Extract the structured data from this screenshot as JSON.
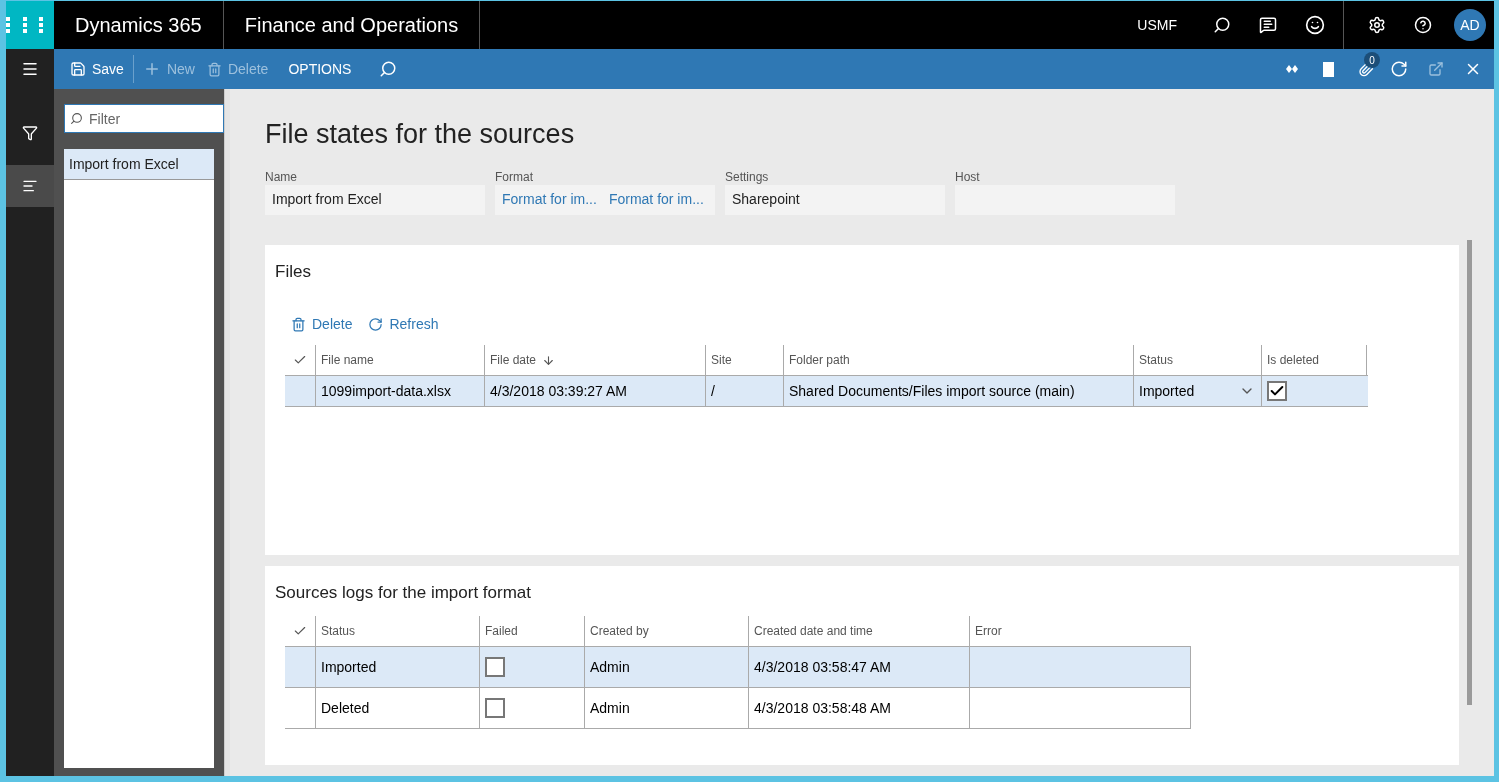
{
  "header": {
    "product": "Dynamics 365",
    "module": "Finance and Operations",
    "company": "USMF",
    "avatar": "AD"
  },
  "action_bar": {
    "buttons": [
      {
        "kind": "save",
        "label": "Save",
        "disabled": false
      },
      {
        "kind": "new",
        "label": "New",
        "disabled": true
      },
      {
        "kind": "delete",
        "label": "Delete",
        "disabled": true
      },
      {
        "kind": "text",
        "label": "OPTIONS",
        "disabled": false
      }
    ],
    "attachments_count": "0"
  },
  "nav_pane": {
    "filter": {
      "placeholder": "Filter"
    },
    "items": [
      {
        "label": "Import from Excel",
        "selected": true
      }
    ]
  },
  "page": {
    "title": "File states for the sources",
    "fields": [
      {
        "label": "Name",
        "kind": "text",
        "values": [
          "Import from Excel"
        ]
      },
      {
        "label": "Format",
        "kind": "links",
        "values": [
          "Format for im...",
          "Format for im..."
        ]
      },
      {
        "label": "Settings",
        "kind": "text",
        "values": [
          "Sharepoint"
        ]
      },
      {
        "label": "Host",
        "kind": "text"
      }
    ]
  },
  "files": {
    "title": "Files",
    "toolbar": [
      {
        "kind": "delete",
        "label": "Delete"
      },
      {
        "kind": "refresh",
        "label": "Refresh"
      }
    ],
    "columns": [
      {
        "label": "File name",
        "sorted": false
      },
      {
        "label": "File date",
        "sorted": true
      },
      {
        "label": "Site",
        "sorted": false
      },
      {
        "label": "Folder path",
        "sorted": false
      },
      {
        "label": "Status",
        "sorted": false
      },
      {
        "label": "Is deleted",
        "sorted": false
      }
    ],
    "rows": [
      {
        "selected": true,
        "file_name": "1099import-data.xlsx",
        "file_date": "4/3/2018 03:39:27 AM",
        "site": "/",
        "folder_path": "Shared Documents/Files import source (main)",
        "status": "Imported",
        "is_deleted": true
      }
    ]
  },
  "logs": {
    "title": "Sources logs for the import format",
    "columns": [
      "Status",
      "Failed",
      "Created by",
      "Created date and time",
      "Error"
    ],
    "rows": [
      {
        "selected": true,
        "status": "Imported",
        "failed": false,
        "created_by": "Admin",
        "created": "4/3/2018 03:58:47 AM"
      },
      {
        "selected": false,
        "status": "Deleted",
        "failed": false,
        "created_by": "Admin",
        "created": "4/3/2018 03:58:48 AM"
      }
    ]
  }
}
